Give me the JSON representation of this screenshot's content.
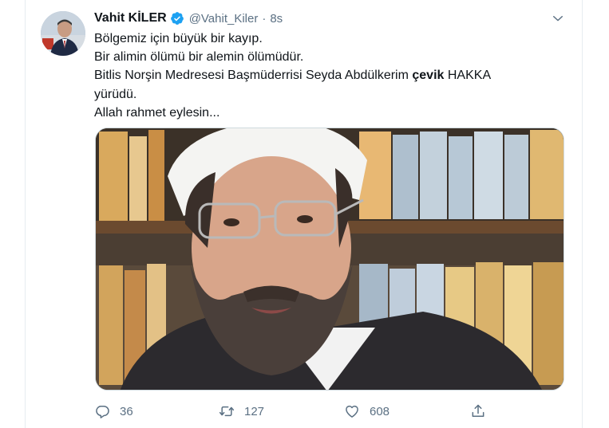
{
  "tweet": {
    "author_name": "Vahit KİLER",
    "handle": "@Vahit_Kiler",
    "separator": "·",
    "timestamp": "8s",
    "text_lines": [
      "Bölgemiz için büyük bir kayıp.",
      "Bir alimin ölümü bir alemin ölümüdür."
    ],
    "line3_before": "Bitlis Norşin Medresesi Başmüderrisi Seyda Abdülkerim ",
    "line3_bold": "çevik",
    "line3_after": " HAKKA",
    "line4": "yürüdü.",
    "line5": "Allah rahmet eylesin...",
    "verified_icon": "verified-badge-icon",
    "accent_color": "#1da1f2"
  },
  "actions": {
    "reply_count": "36",
    "retweet_count": "127",
    "like_count": "608"
  }
}
